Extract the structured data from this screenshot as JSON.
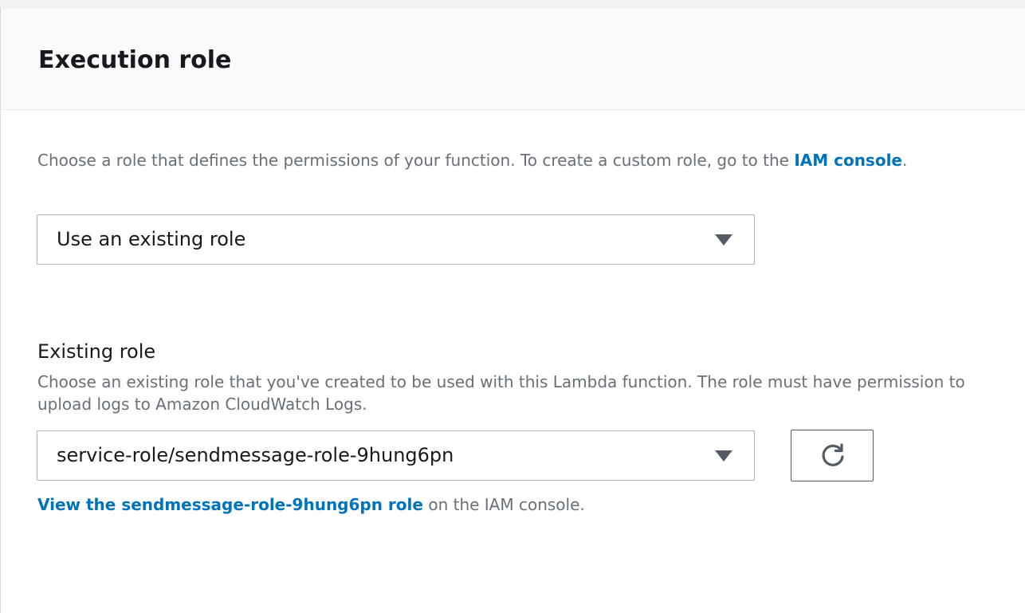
{
  "section": {
    "title": "Execution role"
  },
  "role_choice": {
    "description_text": "Choose a role that defines the permissions of your function. To create a custom role, go to the ",
    "iam_link": "IAM console",
    "description_suffix": ".",
    "selected": "Use an existing role"
  },
  "existing_role": {
    "label": "Existing role",
    "description": "Choose an existing role that you've created to be used with this Lambda function. The role must have permission to upload logs to Amazon CloudWatch Logs.",
    "selected": "service-role/sendmessage-role-9hung6pn",
    "refresh_icon": "refresh-icon",
    "view_link": "View the sendmessage-role-9hung6pn role",
    "view_suffix": " on the IAM console."
  },
  "colors": {
    "link": "#0073bb",
    "text": "#16191f",
    "secondary_text": "#687078",
    "border": "#aab7b8"
  }
}
